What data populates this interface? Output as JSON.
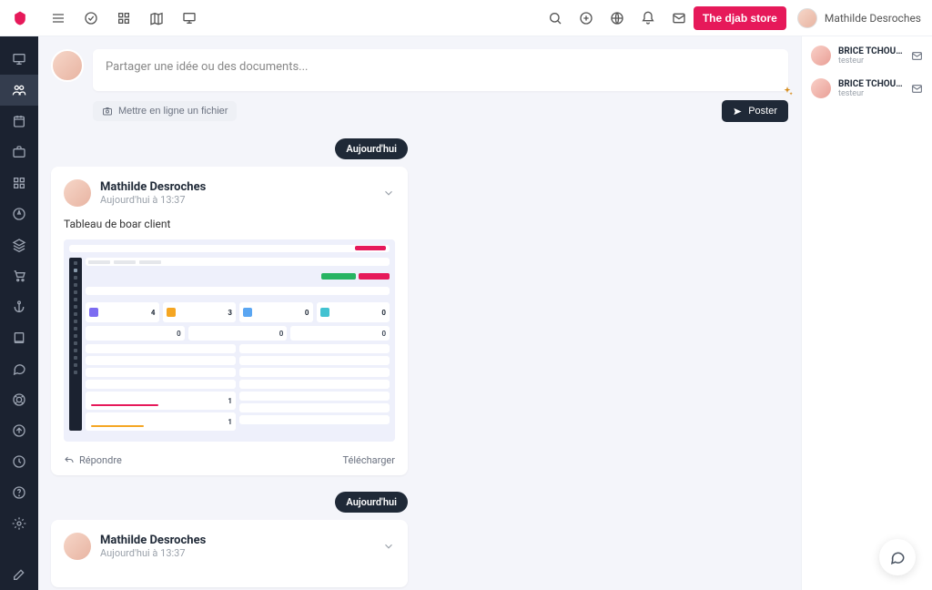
{
  "topbar": {
    "store_button": "The djab store",
    "user_name": "Mathilde Desroches"
  },
  "composer": {
    "placeholder": "Partager une idée ou des documents...",
    "upload_label": "Mettre en ligne un fichier",
    "post_label": "Poster"
  },
  "feed": {
    "day_label": "Aujourd'hui",
    "posts": [
      {
        "author": "Mathilde Desroches",
        "time": "Aujourd'hui à 13:37",
        "body": "Tableau de boar client",
        "reply_label": "Répondre",
        "download_label": "Télécharger"
      },
      {
        "author": "Mathilde Desroches",
        "time": "Aujourd'hui à 13:37"
      }
    ]
  },
  "thumb": {
    "stat1": "4",
    "stat2": "3",
    "stat3": "0",
    "stat4": "0",
    "sub1": "0",
    "sub2": "0",
    "sub3": "0",
    "tally1": "1",
    "tally2": "1"
  },
  "aside": {
    "contacts": [
      {
        "name": "BRICE TCHOULAGUE",
        "role": "testeur"
      },
      {
        "name": "BRICE TCHOULAGUE",
        "role": "testeur"
      }
    ]
  }
}
